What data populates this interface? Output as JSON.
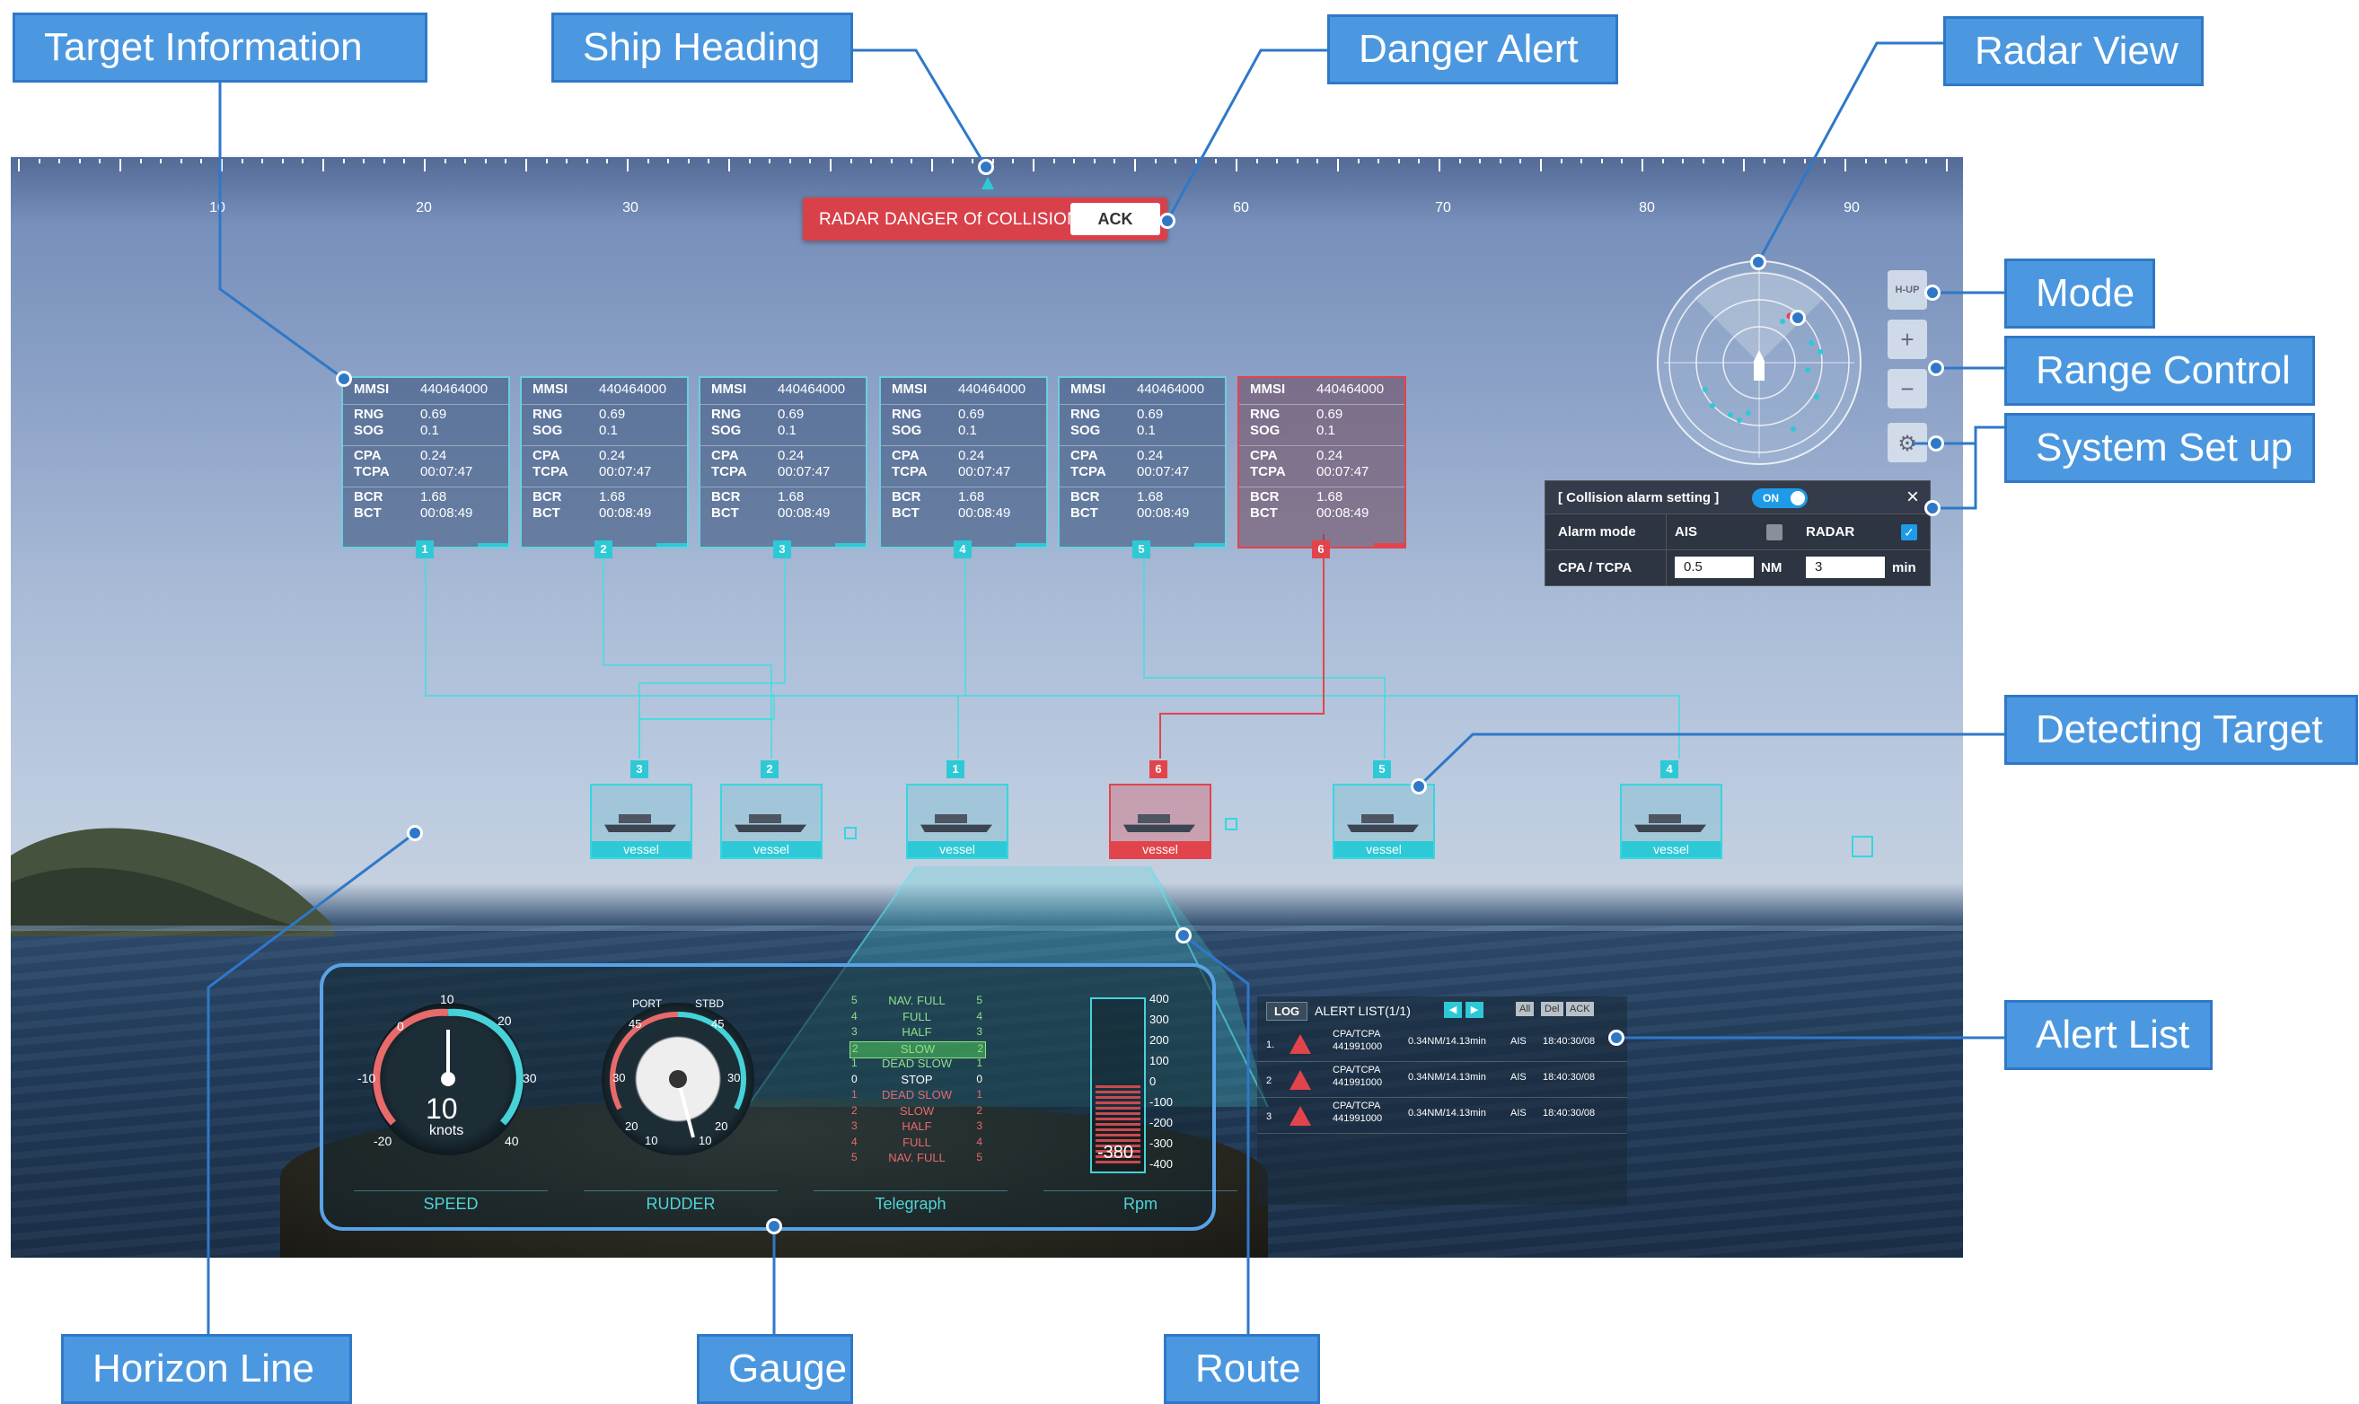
{
  "callouts": {
    "target_information": "Target Information",
    "ship_heading": "Ship Heading",
    "danger_alert": "Danger Alert",
    "radar_view": "Radar View",
    "mode": "Mode",
    "range_control": "Range Control",
    "system_set_up": "System Set up",
    "detecting_target": "Detecting Target",
    "alert_list": "Alert List",
    "horizon_line": "Horizon Line",
    "gauge": "Gauge",
    "route": "Route"
  },
  "heading_ruler": {
    "labels": [
      "10",
      "20",
      "30",
      "60",
      "70",
      "80",
      "90"
    ]
  },
  "danger_alert": {
    "message": "RADAR DANGER Of COLLISION",
    "ack_label": "ACK"
  },
  "targets": [
    {
      "id": "1",
      "mmsi": "440464000",
      "rng": "0.69",
      "sog": "0.1",
      "cpa": "0.24",
      "tcpa": "00:07:47",
      "bcr": "1.68",
      "bct": "00:08:49",
      "danger": false
    },
    {
      "id": "2",
      "mmsi": "440464000",
      "rng": "0.69",
      "sog": "0.1",
      "cpa": "0.24",
      "tcpa": "00:07:47",
      "bcr": "1.68",
      "bct": "00:08:49",
      "danger": false
    },
    {
      "id": "3",
      "mmsi": "440464000",
      "rng": "0.69",
      "sog": "0.1",
      "cpa": "0.24",
      "tcpa": "00:07:47",
      "bcr": "1.68",
      "bct": "00:08:49",
      "danger": false
    },
    {
      "id": "4",
      "mmsi": "440464000",
      "rng": "0.69",
      "sog": "0.1",
      "cpa": "0.24",
      "tcpa": "00:07:47",
      "bcr": "1.68",
      "bct": "00:08:49",
      "danger": false
    },
    {
      "id": "5",
      "mmsi": "440464000",
      "rng": "0.69",
      "sog": "0.1",
      "cpa": "0.24",
      "tcpa": "00:07:47",
      "bcr": "1.68",
      "bct": "00:08:49",
      "danger": false
    },
    {
      "id": "6",
      "mmsi": "440464000",
      "rng": "0.69",
      "sog": "0.1",
      "cpa": "0.24",
      "tcpa": "00:07:47",
      "bcr": "1.68",
      "bct": "00:08:49",
      "danger": true
    }
  ],
  "field_labels": {
    "mmsi": "MMSI",
    "rng": "RNG",
    "sog": "SOG",
    "cpa": "CPA",
    "tcpa": "TCPA",
    "bcr": "BCR",
    "bct": "BCT"
  },
  "vessels": [
    {
      "id": "3",
      "label": "vessel",
      "danger": false
    },
    {
      "id": "2",
      "label": "vessel",
      "danger": false
    },
    {
      "id": "1",
      "label": "vessel",
      "danger": false
    },
    {
      "id": "6",
      "label": "vessel",
      "danger": true
    },
    {
      "id": "5",
      "label": "vessel",
      "danger": false
    },
    {
      "id": "4",
      "label": "vessel",
      "danger": false
    }
  ],
  "radar": {
    "mode_label": "H-UP",
    "zoom_in": "+",
    "zoom_out": "−",
    "settings_icon": "gear-icon"
  },
  "collision_alarm": {
    "title": "[ Collision alarm setting ]",
    "toggle": "ON",
    "alarm_mode_label": "Alarm mode",
    "ais_label": "AIS",
    "radar_label": "RADAR",
    "cpa_tcpa_label": "CPA / TCPA",
    "cpa_value": "0.5",
    "cpa_unit": "NM",
    "tcpa_value": "3",
    "tcpa_unit": "min"
  },
  "gauges": {
    "speed": {
      "label": "SPEED",
      "value": "10",
      "unit": "knots",
      "ticks": [
        "0",
        "10",
        "20",
        "30",
        "40",
        "-10",
        "-20"
      ]
    },
    "rudder": {
      "label": "RUDDER",
      "port": "PORT",
      "stbd": "STBD",
      "ticks": [
        "45",
        "45",
        "30",
        "30",
        "20",
        "20",
        "10",
        "10"
      ]
    },
    "telegraph": {
      "label": "Telegraph",
      "positions": [
        "NAV. FULL",
        "FULL",
        "HALF",
        "SLOW",
        "DEAD SLOW",
        "STOP",
        "DEAD SLOW",
        "SLOW",
        "HALF",
        "FULL",
        "NAV. FULL"
      ],
      "numbers": [
        "5",
        "4",
        "3",
        "2",
        "1",
        "0",
        "1",
        "2",
        "3",
        "4",
        "5"
      ],
      "active": "SLOW"
    },
    "rpm": {
      "label": "Rpm",
      "value": "-380",
      "scale": [
        "400",
        "300",
        "200",
        "100",
        "0",
        "-100",
        "-200",
        "-300",
        "-400"
      ]
    }
  },
  "alert_list": {
    "log_label": "LOG",
    "title": "ALERT LIST(1/1)",
    "buttons": [
      "All",
      "Del",
      "ACK"
    ],
    "rows": [
      {
        "no": "1.",
        "type": "CPA/TCPA",
        "id": "441991000",
        "value": "0.34NM/14.13min",
        "src": "AIS",
        "time": "18:40:30/08"
      },
      {
        "no": "2",
        "type": "CPA/TCPA",
        "id": "441991000",
        "value": "0.34NM/14.13min",
        "src": "AIS",
        "time": "18:40:30/08"
      },
      {
        "no": "3",
        "type": "CPA/TCPA",
        "id": "441991000",
        "value": "0.34NM/14.13min",
        "src": "AIS",
        "time": "18:40:30/08"
      }
    ]
  },
  "colors": {
    "callout": "#4c98e0",
    "callout_line": "#2f78c8",
    "danger": "#e2444c",
    "accent": "#2ec9d6",
    "gauge_border": "#5aa2e8"
  }
}
